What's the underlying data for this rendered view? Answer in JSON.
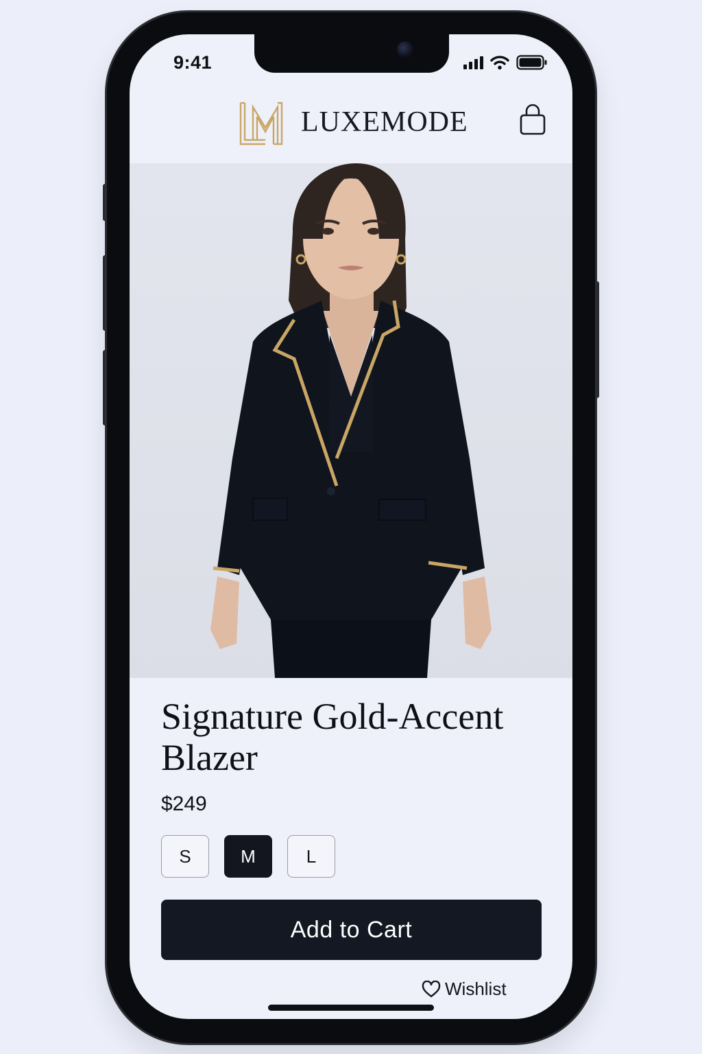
{
  "status_bar": {
    "time": "9:41"
  },
  "header": {
    "brand_name": "LUXEMODE",
    "logo_icon": "lm-monogram-logo",
    "cart_icon": "shopping-bag-icon"
  },
  "product": {
    "image_description_icon": "product-photo",
    "title": "Signature Gold-Accent Blazer",
    "price": "$249",
    "sizes": [
      {
        "label": "S",
        "selected": false
      },
      {
        "label": "M",
        "selected": true
      },
      {
        "label": "L",
        "selected": false
      }
    ],
    "add_to_cart_label": "Add to Cart",
    "wishlist_label": "Wishlist",
    "wishlist_icon": "heart-icon"
  },
  "colors": {
    "accent_gold": "#c9a665",
    "primary_dark": "#141822",
    "background": "#eef0fa"
  }
}
